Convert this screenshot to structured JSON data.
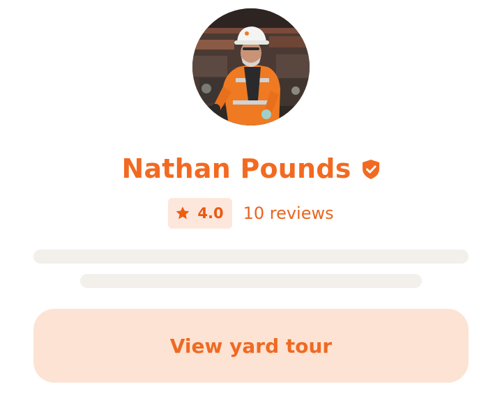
{
  "profile": {
    "name": "Nathan Pounds",
    "avatar_alt": "photo of worker in orange safety jacket and white hard hat",
    "verified_icon": "shield-check-icon"
  },
  "rating": {
    "star_icon": "star-icon",
    "value": "4.0",
    "reviews_label": "10 reviews"
  },
  "action": {
    "label": "View yard tour"
  },
  "colors": {
    "accent": "#f26a21",
    "accent_soft": "#fde3d4",
    "badge_bg": "#fde7dc",
    "skeleton": "#f3efea"
  }
}
